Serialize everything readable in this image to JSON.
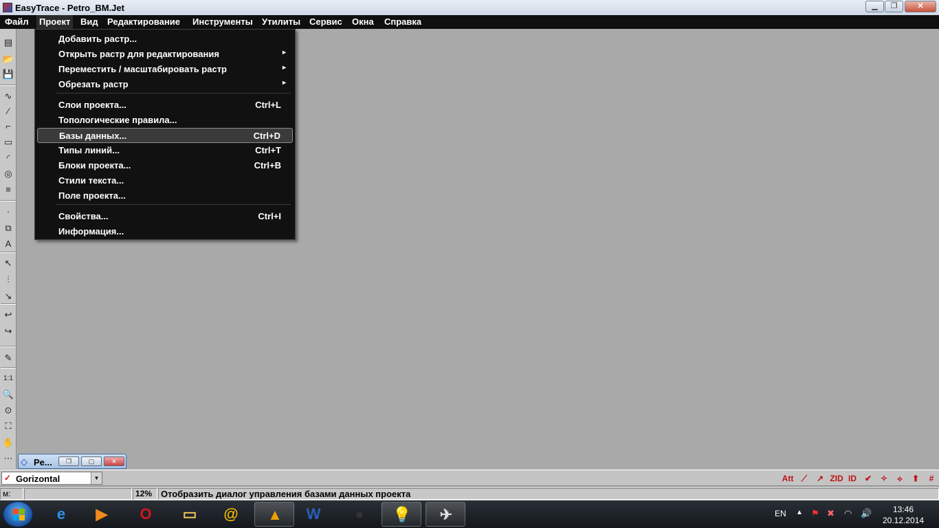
{
  "window": {
    "title": "EasyTrace - Petro_BM.Jet",
    "min": "▁",
    "max": "❐",
    "close": "✕"
  },
  "menubar": [
    "Файл",
    "Проект",
    "Вид",
    "Редактирование",
    "Инструменты",
    "Утилиты",
    "Сервис",
    "Окна",
    "Справка"
  ],
  "project_menu": {
    "items": [
      {
        "label": "Добавить растр...",
        "shortcut": "",
        "submenu": false
      },
      {
        "label": "Открыть растр для редактирования",
        "shortcut": "",
        "submenu": true
      },
      {
        "label": "Переместить / масштабировать растр",
        "shortcut": "",
        "submenu": true
      },
      {
        "label": "Обрезать растр",
        "shortcut": "",
        "submenu": true
      },
      {
        "label": "Слои проекта...",
        "shortcut": "Ctrl+L",
        "submenu": false
      },
      {
        "label": "Топологические правила...",
        "shortcut": "",
        "submenu": false
      },
      {
        "label": "Базы данных...",
        "shortcut": "Ctrl+D",
        "submenu": false,
        "highlighted": true
      },
      {
        "label": "Типы линий...",
        "shortcut": "Ctrl+T",
        "submenu": false
      },
      {
        "label": "Блоки проекта...",
        "shortcut": "Ctrl+B",
        "submenu": false
      },
      {
        "label": "Стили текста...",
        "shortcut": "",
        "submenu": false
      },
      {
        "label": "Поле проекта...",
        "shortcut": "",
        "submenu": false
      },
      {
        "label": "Свойства...",
        "shortcut": "Ctrl+I",
        "submenu": false
      },
      {
        "label": "Информация...",
        "shortcut": "",
        "submenu": false
      }
    ],
    "arrow": "►"
  },
  "left_toolbar_icons": [
    "new-icon",
    "open-icon",
    "save-icon",
    "curve-icon",
    "polyline-icon",
    "step-line-icon",
    "rectangle-icon",
    "arc-icon",
    "circle-icon",
    "hatch-icon",
    "point-icon",
    "block-icon",
    "text-icon",
    "select-icon",
    "multi-select-icon",
    "select-node-icon",
    "undo-arrow-icon",
    "redo-arrow-icon",
    "pencil-icon",
    "zoom-1-1-icon",
    "zoom-icon",
    "zoom-area-icon",
    "zoom-extents-icon",
    "pan-hand-icon",
    "measure-icon"
  ],
  "left_toolbar_glyphs": [
    "▤",
    "📂",
    "💾",
    "∿",
    "⁄",
    "⌐",
    "▭",
    "◜",
    "◎",
    "≡",
    "·",
    "⧉",
    "A",
    "↖",
    "⫶",
    "↘",
    "↩",
    "↪",
    "✎",
    "1:1",
    "🔍",
    "⊙",
    "⛶",
    "✋",
    "⋯"
  ],
  "mdi_child": {
    "title": "Pe...",
    "icon": "◇"
  },
  "layer_combo": {
    "value": "Gorizontal",
    "check": "✓",
    "dropdown": "▼"
  },
  "right_toolbar": [
    "Att",
    "⟋",
    "↗",
    "ZID",
    "ID",
    "✔",
    "✧",
    "⟡",
    "⬆",
    "#"
  ],
  "status": {
    "m_label": "м:",
    "coords": "",
    "zoom": "12%",
    "hint": "Отобразить диалог управления базами данных проекта"
  },
  "taskbar": {
    "apps": [
      {
        "name": "ie-icon",
        "glyph": "e",
        "color": "#2f8fe8"
      },
      {
        "name": "media-player-icon",
        "glyph": "▶",
        "color": "#f08a1c"
      },
      {
        "name": "opera-icon",
        "glyph": "O",
        "color": "#d0161c"
      },
      {
        "name": "explorer-icon",
        "glyph": "▭",
        "color": "#e8c25a"
      },
      {
        "name": "mail-icon",
        "glyph": "@",
        "color": "#f5b800"
      },
      {
        "name": "aimp-icon",
        "glyph": "▲",
        "color": "#e6a100"
      },
      {
        "name": "word-icon",
        "glyph": "W",
        "color": "#2b5fb8"
      },
      {
        "name": "app-circle-icon",
        "glyph": "●",
        "color": "#333"
      },
      {
        "name": "lightbulb-icon",
        "glyph": "💡",
        "color": "#ffe14a"
      },
      {
        "name": "paper-plane-icon",
        "glyph": "✈",
        "color": "#ddd"
      }
    ],
    "language": "EN",
    "time": "13:46",
    "date": "20.12.2014"
  }
}
